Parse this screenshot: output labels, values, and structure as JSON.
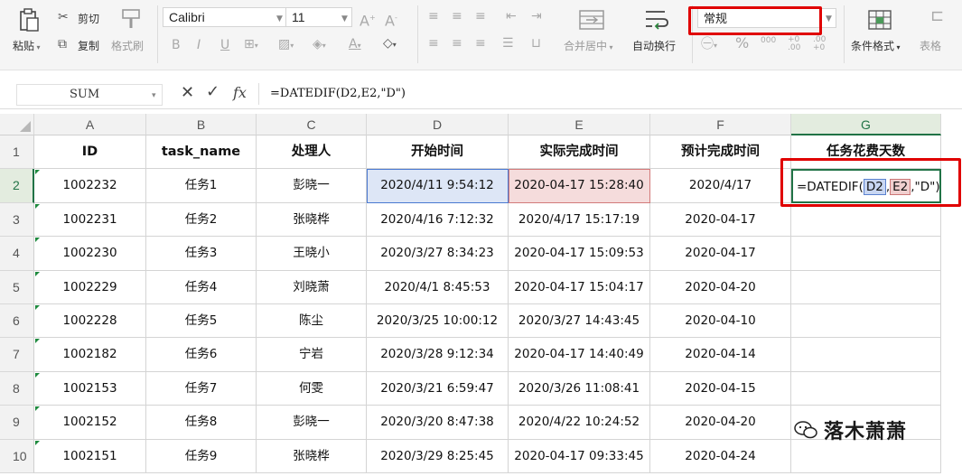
{
  "ribbon": {
    "paste_label": "粘贴",
    "cut_label": "剪切",
    "copy_label": "复制",
    "format_painter_label": "格式刷",
    "font_name": "Calibri",
    "font_size": "11",
    "merge_center_label": "合并居中",
    "wrap_text_label": "自动换行",
    "number_format": "常规",
    "conditional_format_label": "条件格式",
    "table_style_label": "表格"
  },
  "formula_bar": {
    "name_box": "SUM",
    "fx_label": "fx",
    "formula": "=DATEDIF(D2,E2,\"D\")"
  },
  "columns": [
    "A",
    "B",
    "C",
    "D",
    "E",
    "F",
    "G"
  ],
  "row_numbers": [
    "1",
    "2",
    "3",
    "4",
    "5",
    "6",
    "7",
    "8",
    "9",
    "10"
  ],
  "headers": [
    "ID",
    "task_name",
    "处理人",
    "开始时间",
    "实际完成时间",
    "预计完成时间",
    "任务花费天数"
  ],
  "rows": [
    [
      "1002232",
      "任务1",
      "彭晓一",
      "2020/4/11 9:54:12",
      "2020-04-17 15:28:40",
      "2020/4/17",
      ""
    ],
    [
      "1002231",
      "任务2",
      "张晓桦",
      "2020/4/16 7:12:32",
      "2020/4/17 15:17:19",
      "2020-04-17",
      ""
    ],
    [
      "1002230",
      "任务3",
      "王晓小",
      "2020/3/27 8:34:23",
      "2020-04-17 15:09:53",
      "2020-04-17",
      ""
    ],
    [
      "1002229",
      "任务4",
      "刘晓萧",
      "2020/4/1 8:45:53",
      "2020-04-17 15:04:17",
      "2020-04-20",
      ""
    ],
    [
      "1002228",
      "任务5",
      "陈尘",
      "2020/3/25 10:00:12",
      "2020/3/27 14:43:45",
      "2020-04-10",
      ""
    ],
    [
      "1002182",
      "任务6",
      "宁岩",
      "2020/3/28 9:12:34",
      "2020-04-17 14:40:49",
      "2020-04-14",
      ""
    ],
    [
      "1002153",
      "任务7",
      "何雯",
      "2020/3/21 6:59:47",
      "2020/3/26 11:08:41",
      "2020-04-15",
      ""
    ],
    [
      "1002152",
      "任务8",
      "彭晓一",
      "2020/3/20 8:47:38",
      "2020/4/22 10:24:52",
      "2020-04-20",
      ""
    ],
    [
      "1002151",
      "任务9",
      "张晓桦",
      "2020/3/29 8:25:45",
      "2020-04-17 09:33:45",
      "2020-04-24",
      ""
    ]
  ],
  "active_cell_formula": {
    "prefix": "=DATEDIF(",
    "ref1": "D2",
    "comma": ",",
    "ref2": "E2",
    "suffix": ",\"D\")"
  },
  "watermark": "落木萧萧",
  "colors": {
    "accent_green": "#217346",
    "highlight_red": "#e00000",
    "ref_blue_fill": "#dde6f6",
    "ref_red_fill": "#f5dcdc"
  }
}
